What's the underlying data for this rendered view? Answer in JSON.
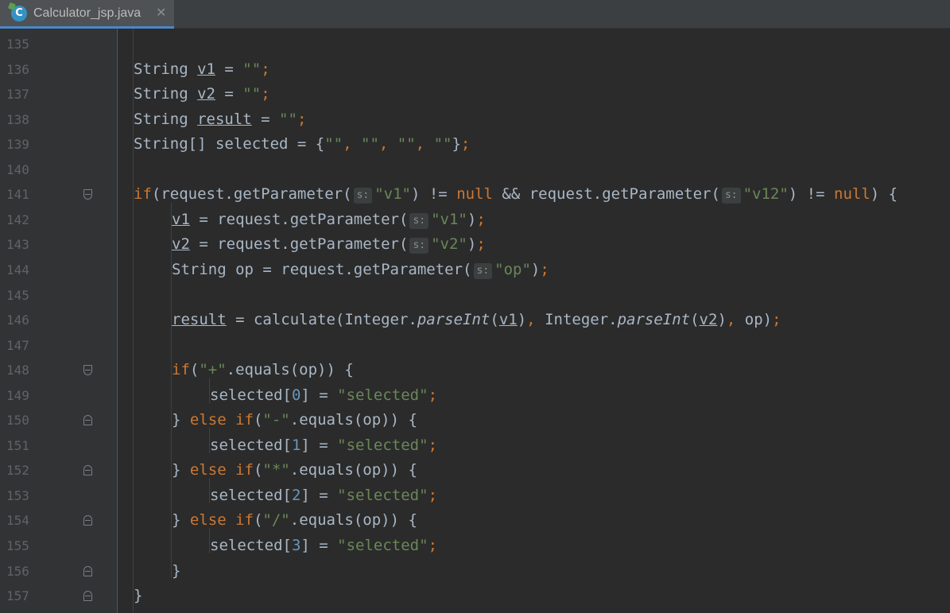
{
  "tab": {
    "title": "Calculator_jsp.java",
    "close": "✕",
    "icon_letter": "C",
    "icon_name": "java-class-icon"
  },
  "hint_label": "s:",
  "line_numbers": [
    "135",
    "136",
    "137",
    "138",
    "139",
    "140",
    "141",
    "142",
    "143",
    "144",
    "145",
    "146",
    "147",
    "148",
    "149",
    "150",
    "151",
    "152",
    "153",
    "154",
    "155",
    "156",
    "157"
  ],
  "colors": {
    "keyword": "#cc7832",
    "string": "#6a8759",
    "number": "#6897bb",
    "text": "#a9b7c6",
    "background": "#2b2b2b"
  },
  "code_lines": [
    {
      "indent": 0,
      "tokens": []
    },
    {
      "indent": 1,
      "tokens": [
        [
          "t",
          "String "
        ],
        [
          "u",
          "v1"
        ],
        [
          "t",
          " = "
        ],
        [
          "s",
          "\"\""
        ],
        [
          "k",
          ";"
        ]
      ]
    },
    {
      "indent": 1,
      "tokens": [
        [
          "t",
          "String "
        ],
        [
          "u",
          "v2"
        ],
        [
          "t",
          " = "
        ],
        [
          "s",
          "\"\""
        ],
        [
          "k",
          ";"
        ]
      ]
    },
    {
      "indent": 1,
      "tokens": [
        [
          "t",
          "String "
        ],
        [
          "u",
          "result"
        ],
        [
          "t",
          " = "
        ],
        [
          "s",
          "\"\""
        ],
        [
          "k",
          ";"
        ]
      ]
    },
    {
      "indent": 1,
      "tokens": [
        [
          "t",
          "String[] selected = {"
        ],
        [
          "s",
          "\"\""
        ],
        [
          "k",
          ", "
        ],
        [
          "s",
          "\"\""
        ],
        [
          "k",
          ", "
        ],
        [
          "s",
          "\"\""
        ],
        [
          "k",
          ", "
        ],
        [
          "s",
          "\"\""
        ],
        [
          "t",
          "}"
        ],
        [
          "k",
          ";"
        ]
      ]
    },
    {
      "indent": 0,
      "tokens": []
    },
    {
      "indent": 1,
      "tokens": [
        [
          "k",
          "if"
        ],
        [
          "t",
          "(request.getParameter("
        ],
        [
          "h",
          "s:"
        ],
        [
          "s",
          "\"v1\""
        ],
        [
          "t",
          ") != "
        ],
        [
          "k",
          "null"
        ],
        [
          "t",
          " && request.getParameter("
        ],
        [
          "h",
          "s:"
        ],
        [
          "s",
          "\"v12\""
        ],
        [
          "t",
          ") != "
        ],
        [
          "k",
          "null"
        ],
        [
          "t",
          ") {"
        ]
      ]
    },
    {
      "indent": 2,
      "tokens": [
        [
          "u",
          "v1"
        ],
        [
          "t",
          " = request.getParameter("
        ],
        [
          "h",
          "s:"
        ],
        [
          "s",
          "\"v1\""
        ],
        [
          "t",
          ")"
        ],
        [
          "k",
          ";"
        ]
      ]
    },
    {
      "indent": 2,
      "tokens": [
        [
          "u",
          "v2"
        ],
        [
          "t",
          " = request.getParameter("
        ],
        [
          "h",
          "s:"
        ],
        [
          "s",
          "\"v2\""
        ],
        [
          "t",
          ")"
        ],
        [
          "k",
          ";"
        ]
      ]
    },
    {
      "indent": 2,
      "tokens": [
        [
          "t",
          "String op = request.getParameter("
        ],
        [
          "h",
          "s:"
        ],
        [
          "s",
          "\"op\""
        ],
        [
          "t",
          ")"
        ],
        [
          "k",
          ";"
        ]
      ]
    },
    {
      "indent": 0,
      "tokens": []
    },
    {
      "indent": 2,
      "tokens": [
        [
          "u",
          "result"
        ],
        [
          "t",
          " = calculate(Integer."
        ],
        [
          "i",
          "parseInt"
        ],
        [
          "t",
          "("
        ],
        [
          "u",
          "v1"
        ],
        [
          "t",
          ")"
        ],
        [
          "k",
          ", "
        ],
        [
          "t",
          "Integer."
        ],
        [
          "i",
          "parseInt"
        ],
        [
          "t",
          "("
        ],
        [
          "u",
          "v2"
        ],
        [
          "t",
          ")"
        ],
        [
          "k",
          ", "
        ],
        [
          "t",
          "op)"
        ],
        [
          "k",
          ";"
        ]
      ]
    },
    {
      "indent": 0,
      "tokens": []
    },
    {
      "indent": 2,
      "tokens": [
        [
          "k",
          "if"
        ],
        [
          "t",
          "("
        ],
        [
          "s",
          "\"+\""
        ],
        [
          "t",
          ".equals(op)) {"
        ]
      ]
    },
    {
      "indent": 3,
      "tokens": [
        [
          "t",
          "selected["
        ],
        [
          "n",
          "0"
        ],
        [
          "t",
          "] = "
        ],
        [
          "s",
          "\"selected\""
        ],
        [
          "k",
          ";"
        ]
      ]
    },
    {
      "indent": 2,
      "tokens": [
        [
          "t",
          "} "
        ],
        [
          "k",
          "else if"
        ],
        [
          "t",
          "("
        ],
        [
          "s",
          "\"-\""
        ],
        [
          "t",
          ".equals(op)) {"
        ]
      ]
    },
    {
      "indent": 3,
      "tokens": [
        [
          "t",
          "selected["
        ],
        [
          "n",
          "1"
        ],
        [
          "t",
          "] = "
        ],
        [
          "s",
          "\"selected\""
        ],
        [
          "k",
          ";"
        ]
      ]
    },
    {
      "indent": 2,
      "tokens": [
        [
          "t",
          "} "
        ],
        [
          "k",
          "else if"
        ],
        [
          "t",
          "("
        ],
        [
          "s",
          "\"*\""
        ],
        [
          "t",
          ".equals(op)) {"
        ]
      ]
    },
    {
      "indent": 3,
      "tokens": [
        [
          "t",
          "selected["
        ],
        [
          "n",
          "2"
        ],
        [
          "t",
          "] = "
        ],
        [
          "s",
          "\"selected\""
        ],
        [
          "k",
          ";"
        ]
      ]
    },
    {
      "indent": 2,
      "tokens": [
        [
          "t",
          "} "
        ],
        [
          "k",
          "else if"
        ],
        [
          "t",
          "("
        ],
        [
          "s",
          "\"/\""
        ],
        [
          "t",
          ".equals(op)) {"
        ]
      ]
    },
    {
      "indent": 3,
      "tokens": [
        [
          "t",
          "selected["
        ],
        [
          "n",
          "3"
        ],
        [
          "t",
          "] = "
        ],
        [
          "s",
          "\"selected\""
        ],
        [
          "k",
          ";"
        ]
      ]
    },
    {
      "indent": 2,
      "tokens": [
        [
          "t",
          "}"
        ]
      ]
    },
    {
      "indent": 1,
      "tokens": [
        [
          "t",
          "}"
        ]
      ]
    }
  ],
  "folds": [
    {
      "line": "141",
      "kind": "open"
    },
    {
      "line": "148",
      "kind": "open"
    },
    {
      "line": "150",
      "kind": "close"
    },
    {
      "line": "152",
      "kind": "close"
    },
    {
      "line": "154",
      "kind": "close"
    },
    {
      "line": "156",
      "kind": "close"
    },
    {
      "line": "157",
      "kind": "close"
    }
  ]
}
